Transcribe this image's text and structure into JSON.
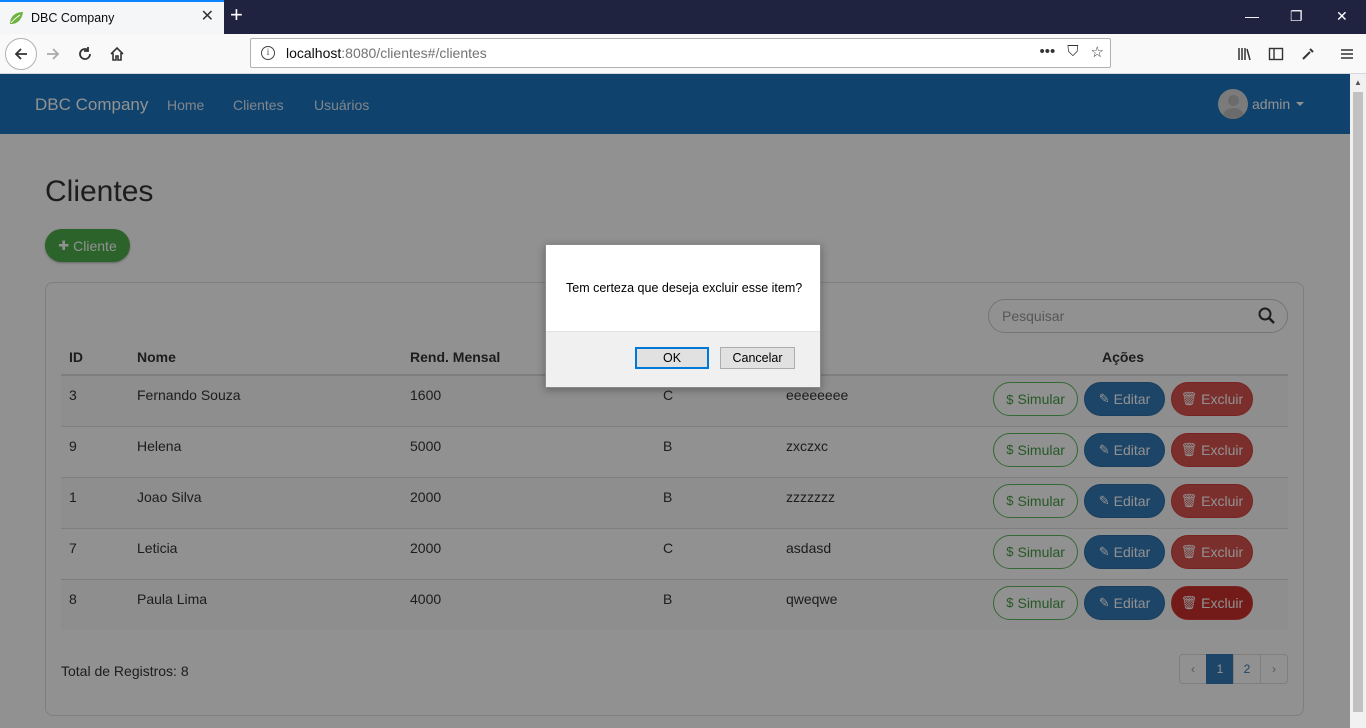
{
  "browser": {
    "tab_title": "DBC Company",
    "url_host": "localhost",
    "url_rest": ":8080/clientes#/clientes"
  },
  "nav": {
    "brand": "DBC Company",
    "links": [
      "Home",
      "Clientes",
      "Usuários"
    ],
    "user": "admin"
  },
  "page": {
    "title": "Clientes",
    "add_button": "Cliente",
    "search_placeholder": "Pesquisar",
    "columns": [
      "ID",
      "Nome",
      "Rend. Mensal",
      "",
      "reço",
      "Ações"
    ],
    "rows": [
      {
        "id": "3",
        "nome": "Fernando Souza",
        "renda": "1600",
        "classe": "C",
        "endereco": "eeeeeeee"
      },
      {
        "id": "9",
        "nome": "Helena",
        "renda": "5000",
        "classe": "B",
        "endereco": "zxczxc"
      },
      {
        "id": "1",
        "nome": "Joao Silva",
        "renda": "2000",
        "classe": "B",
        "endereco": "zzzzzzz"
      },
      {
        "id": "7",
        "nome": "Leticia",
        "renda": "2000",
        "classe": "C",
        "endereco": "asdasd"
      },
      {
        "id": "8",
        "nome": "Paula Lima",
        "renda": "4000",
        "classe": "B",
        "endereco": "qweqwe"
      }
    ],
    "actions": {
      "simular": "Simular",
      "editar": "Editar",
      "excluir": "Excluir"
    },
    "total": "Total de Registros: 8",
    "pager": {
      "prev": "‹",
      "pages": [
        "1",
        "2"
      ],
      "next": "›",
      "active": "1"
    }
  },
  "dialog": {
    "message": "Tem certeza que deseja excluir esse item?",
    "ok": "OK",
    "cancel": "Cancelar"
  },
  "colors": {
    "navbar": "#1b74bf",
    "success": "#5cb85c",
    "primary": "#337ab7",
    "danger": "#d9534f"
  }
}
